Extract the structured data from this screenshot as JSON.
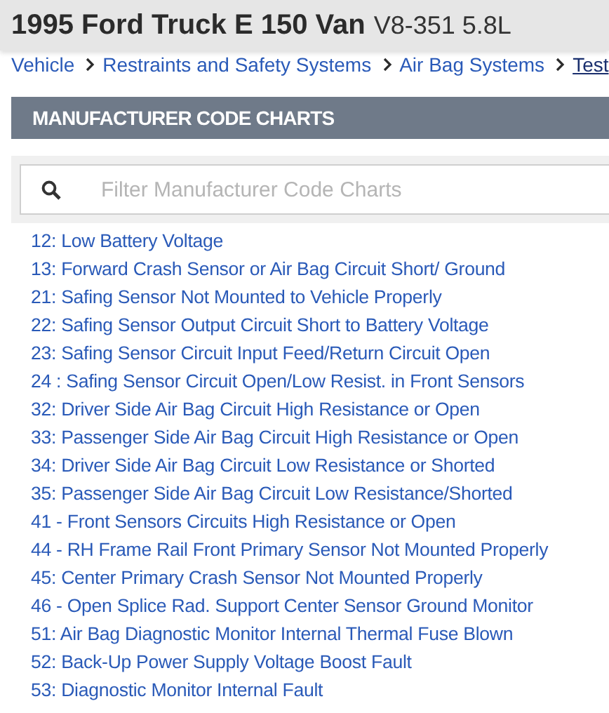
{
  "header": {
    "title": "1995 Ford Truck E 150 Van",
    "engine": "V8-351 5.8L"
  },
  "breadcrumb": [
    {
      "label": "Vehicle",
      "current": false
    },
    {
      "label": "Restraints and Safety Systems",
      "current": false
    },
    {
      "label": "Air Bag Systems",
      "current": false
    },
    {
      "label": "Test",
      "current": true
    }
  ],
  "section": {
    "title": "MANUFACTURER CODE CHARTS"
  },
  "search": {
    "placeholder": "Filter Manufacturer Code Charts"
  },
  "codes": [
    "12: Low Battery Voltage",
    "13: Forward Crash Sensor or Air Bag Circuit Short/ Ground",
    "21: Safing Sensor Not Mounted to Vehicle Properly",
    "22: Safing Sensor Output Circuit Short to Battery Voltage",
    "23: Safing Sensor Circuit Input Feed/Return Circuit Open",
    "24 : Safing Sensor Circuit Open/Low Resist. in Front Sensors",
    "32: Driver Side Air Bag Circuit High Resistance or Open",
    "33: Passenger Side Air Bag Circuit High Resistance or Open",
    "34: Driver Side Air Bag Circuit Low Resistance or Shorted",
    "35: Passenger Side Air Bag Circuit Low Resistance/Shorted",
    "41 - Front Sensors Circuits High Resistance or Open",
    "44 - RH Frame Rail Front Primary Sensor Not Mounted Properly",
    "45: Center Primary Crash Sensor Not Mounted Properly",
    "46 - Open Splice Rad. Support Center Sensor Ground Monitor",
    "51: Air Bag Diagnostic Monitor Internal Thermal Fuse Blown",
    "52: Back-Up Power Supply Voltage Boost Fault",
    "53: Diagnostic Monitor Internal Fault"
  ]
}
